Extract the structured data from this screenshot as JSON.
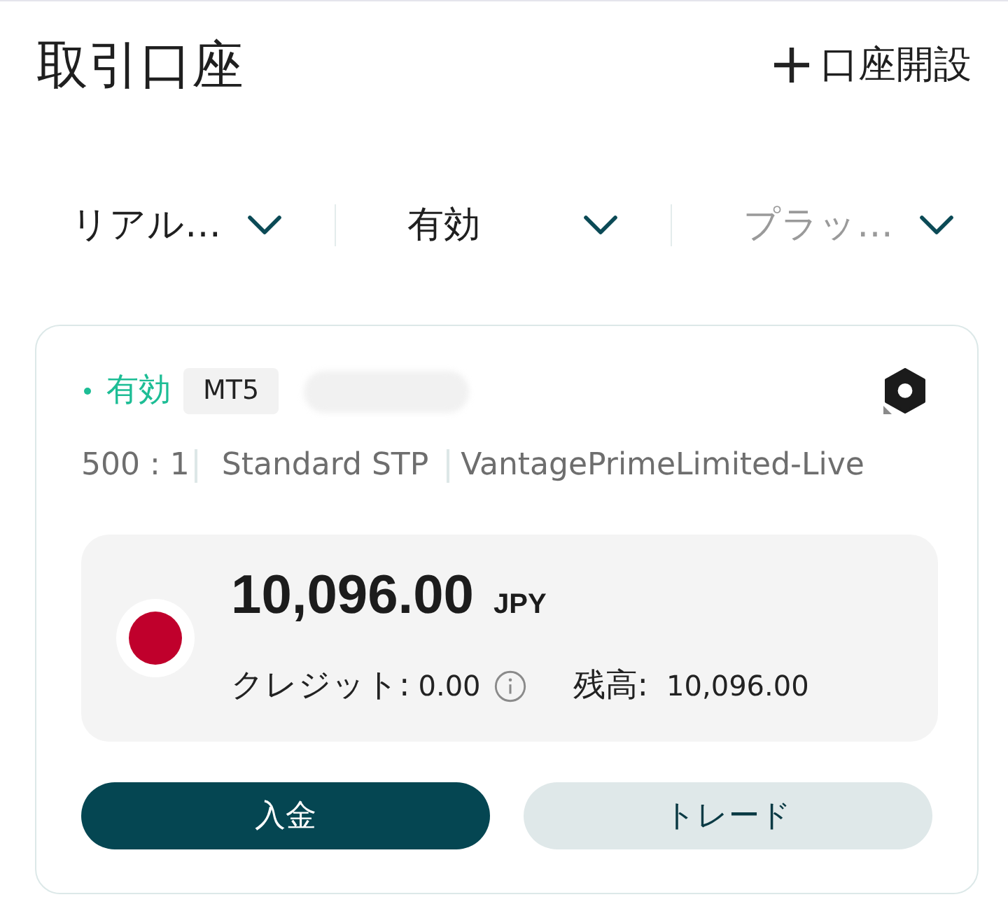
{
  "header": {
    "title": "取引口座",
    "action": {
      "label": "口座開設"
    }
  },
  "filters": [
    {
      "value": "リアル…"
    },
    {
      "value": "有効"
    },
    {
      "placeholder": "プラッ…"
    }
  ],
  "account": {
    "status": "有効",
    "platform": "MT5",
    "name_redacted": true,
    "details": [
      "500 : 1",
      "Standard STP",
      "VantagePrimeLimited-Live"
    ],
    "balance": {
      "amount": "10,096.00",
      "currency": "JPY",
      "credit_label": "クレジット:",
      "credit_value": "0.00",
      "balance_label": "残高:",
      "balance_value": "10,096.00"
    },
    "buttons": [
      {
        "label": "入金",
        "kind": "primary"
      },
      {
        "label": "トレード",
        "kind": "secondary"
      }
    ]
  }
}
